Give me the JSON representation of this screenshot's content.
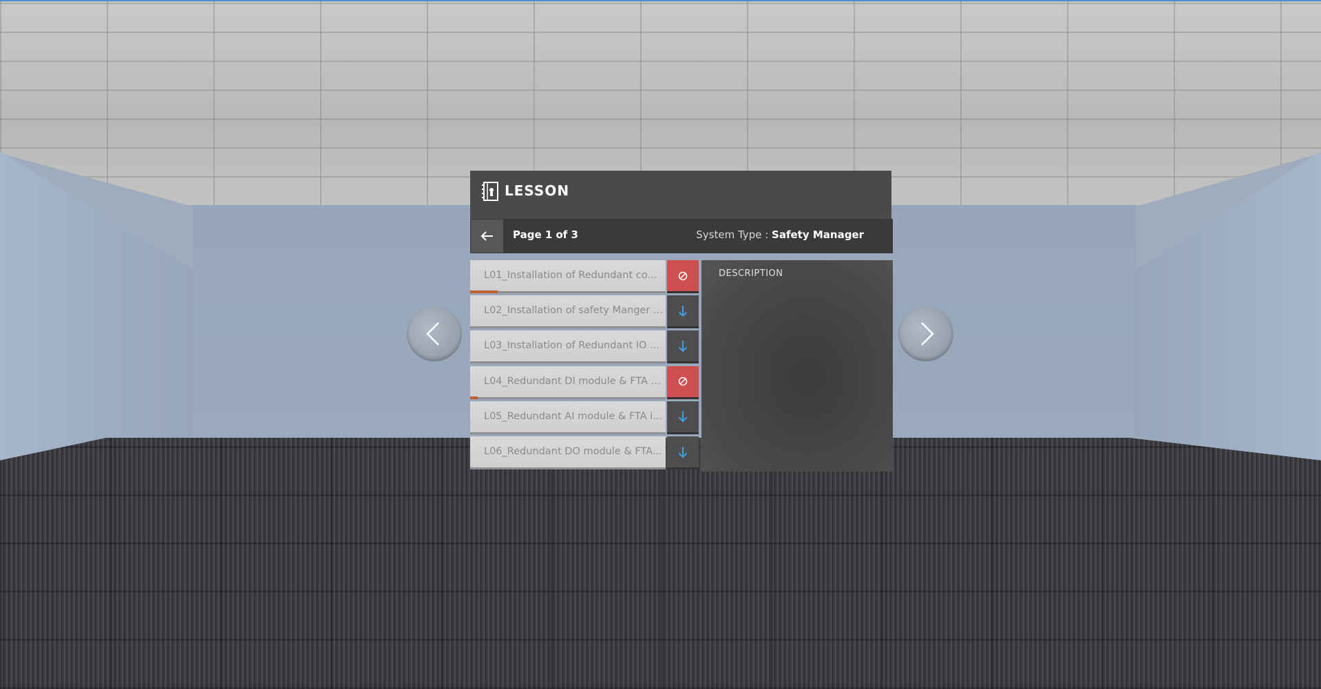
{
  "panel": {
    "title": "LESSON",
    "page_label": "Page 1 of 3",
    "system_type_label": "System Type :",
    "system_type_value": "Safety Manager",
    "description_title": "DESCRIPTION"
  },
  "lessons": [
    {
      "name": "L01_Installation of Redundant co...",
      "action": "blocked",
      "progress": 0.14
    },
    {
      "name": "L02_Installation of safety Manger ...",
      "action": "download",
      "progress": 0
    },
    {
      "name": "L03_Installation of Redundant IO ...",
      "action": "download",
      "progress": 0
    },
    {
      "name": "L04_Redundant DI module & FTA i...",
      "action": "blocked",
      "progress": 0.04
    },
    {
      "name": "L05_Redundant AI module & FTA i...",
      "action": "download",
      "progress": 0
    },
    {
      "name": "L06_Redundant DO module & FTA...",
      "action": "download",
      "progress": 0
    }
  ],
  "icons": {
    "lesson": "book-icon",
    "back": "arrow-left-icon",
    "blocked": "blocked-icon",
    "download": "download-icon",
    "prev": "chevron-left-icon",
    "next": "chevron-right-icon"
  },
  "colors": {
    "blocked": "#cf4e4f",
    "download_arrow": "#3ea0e6",
    "progress": "#c0602e"
  }
}
